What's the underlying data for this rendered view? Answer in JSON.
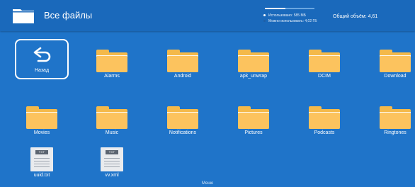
{
  "header": {
    "title": "Все файлы",
    "icon": "folder-icon",
    "storage": {
      "used_label": "Использовано: 585 МБ",
      "free_label": "Можно использовать: 4,02 ГБ",
      "total_label": "Общий объём: 4,61",
      "used_fraction": 0.42,
      "used_color": "#ffffff",
      "free_color": "#1f5fa6"
    }
  },
  "back": {
    "label": "Назад",
    "icon": "back-arrow-icon"
  },
  "items": [
    {
      "label": "Alarms",
      "type": "folder"
    },
    {
      "label": "Android",
      "type": "folder"
    },
    {
      "label": "apk_unwrap",
      "type": "folder"
    },
    {
      "label": "DCIM",
      "type": "folder"
    },
    {
      "label": "Download",
      "type": "folder"
    },
    {
      "label": "Movies",
      "type": "folder"
    },
    {
      "label": "Music",
      "type": "folder"
    },
    {
      "label": "Notifications",
      "type": "folder"
    },
    {
      "label": "Pictures",
      "type": "folder"
    },
    {
      "label": "Podcasts",
      "type": "folder"
    },
    {
      "label": "Ringtones",
      "type": "folder"
    },
    {
      "label": "uuid.txt",
      "type": "file",
      "badge": "TXT"
    },
    {
      "label": "vv.xml",
      "type": "file",
      "badge": "TXT"
    }
  ],
  "footer": {
    "label": "Меню"
  },
  "colors": {
    "background": "#1f74c9",
    "topbar": "#1a69bb",
    "folder": "#f4b94a",
    "folder_front": "#fcc35e"
  }
}
